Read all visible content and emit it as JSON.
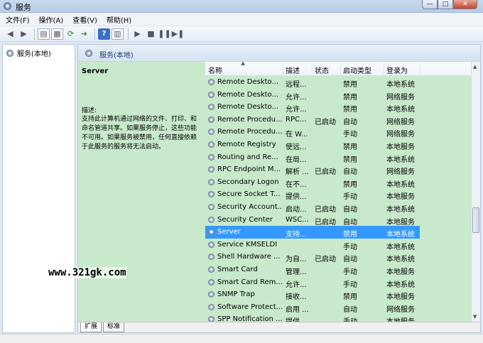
{
  "window": {
    "title": "服务",
    "min": "—",
    "max": "□",
    "close": "✕"
  },
  "menu": [
    "文件(F)",
    "操作(A)",
    "查看(V)",
    "帮助(H)"
  ],
  "tree": {
    "root": "服务(本地)"
  },
  "main_header": "服务(本地)",
  "detail": {
    "service_name": "Server",
    "desc_label": "描述:",
    "desc_text": "支持此计算机通过网络的文件、打印、和命名管道共享。如果服务停止，这些功能不可用。如果服务被禁用，任何直接依赖于此服务的服务将无法启动。"
  },
  "columns": {
    "name": "名称",
    "desc": "描述",
    "status": "状态",
    "startup": "启动类型",
    "logon": "登录为"
  },
  "services": [
    {
      "name": "Remote Deskto...",
      "desc": "远程...",
      "status": "",
      "startup": "禁用",
      "logon": "本地系统"
    },
    {
      "name": "Remote Deskto...",
      "desc": "允许...",
      "status": "",
      "startup": "禁用",
      "logon": "网络服务"
    },
    {
      "name": "Remote Deskto...",
      "desc": "允许...",
      "status": "",
      "startup": "禁用",
      "logon": "本地系统"
    },
    {
      "name": "Remote Procedu...",
      "desc": "RPC...",
      "status": "已启动",
      "startup": "自动",
      "logon": "网络服务"
    },
    {
      "name": "Remote Procedu...",
      "desc": "在 W...",
      "status": "",
      "startup": "手动",
      "logon": "网络服务"
    },
    {
      "name": "Remote Registry",
      "desc": "使远...",
      "status": "",
      "startup": "禁用",
      "logon": "本地服务"
    },
    {
      "name": "Routing and Re...",
      "desc": "在局...",
      "status": "",
      "startup": "禁用",
      "logon": "本地系统"
    },
    {
      "name": "RPC Endpoint M...",
      "desc": "解析 ...",
      "status": "已启动",
      "startup": "自动",
      "logon": "网络服务"
    },
    {
      "name": "Secondary Logon",
      "desc": "在不...",
      "status": "",
      "startup": "禁用",
      "logon": "本地系统"
    },
    {
      "name": "Secure Socket T...",
      "desc": "提供...",
      "status": "",
      "startup": "手动",
      "logon": "本地服务"
    },
    {
      "name": "Security Account...",
      "desc": "启动...",
      "status": "已启动",
      "startup": "自动",
      "logon": "本地系统"
    },
    {
      "name": "Security Center",
      "desc": "WSC...",
      "status": "已启动",
      "startup": "自动",
      "logon": "本地服务"
    },
    {
      "name": "Server",
      "desc": "支持...",
      "status": "",
      "startup": "禁用",
      "logon": "本地系统",
      "selected": true
    },
    {
      "name": "Service KMSELDI",
      "desc": "",
      "status": "",
      "startup": "手动",
      "logon": "本地系统"
    },
    {
      "name": "Shell Hardware ...",
      "desc": "为自...",
      "status": "已启动",
      "startup": "自动",
      "logon": "本地系统"
    },
    {
      "name": "Smart Card",
      "desc": "管理...",
      "status": "",
      "startup": "手动",
      "logon": "本地服务"
    },
    {
      "name": "Smart Card Rem...",
      "desc": "允许...",
      "status": "",
      "startup": "手动",
      "logon": "本地系统"
    },
    {
      "name": "SNMP Trap",
      "desc": "接收...",
      "status": "",
      "startup": "禁用",
      "logon": "本地服务"
    },
    {
      "name": "Software Protect...",
      "desc": "启用 ...",
      "status": "",
      "startup": "自动",
      "logon": "网络服务"
    },
    {
      "name": "SPP Notification ...",
      "desc": "提供 ...",
      "status": "",
      "startup": "手动",
      "logon": "本地服务"
    }
  ],
  "tabs": [
    "扩展",
    "标准"
  ],
  "watermark": "www.321gk.com",
  "colors": {
    "detail_bg": "#c8e9cc",
    "selection": "#3399ff",
    "window_frame": "#dfe9f5"
  }
}
